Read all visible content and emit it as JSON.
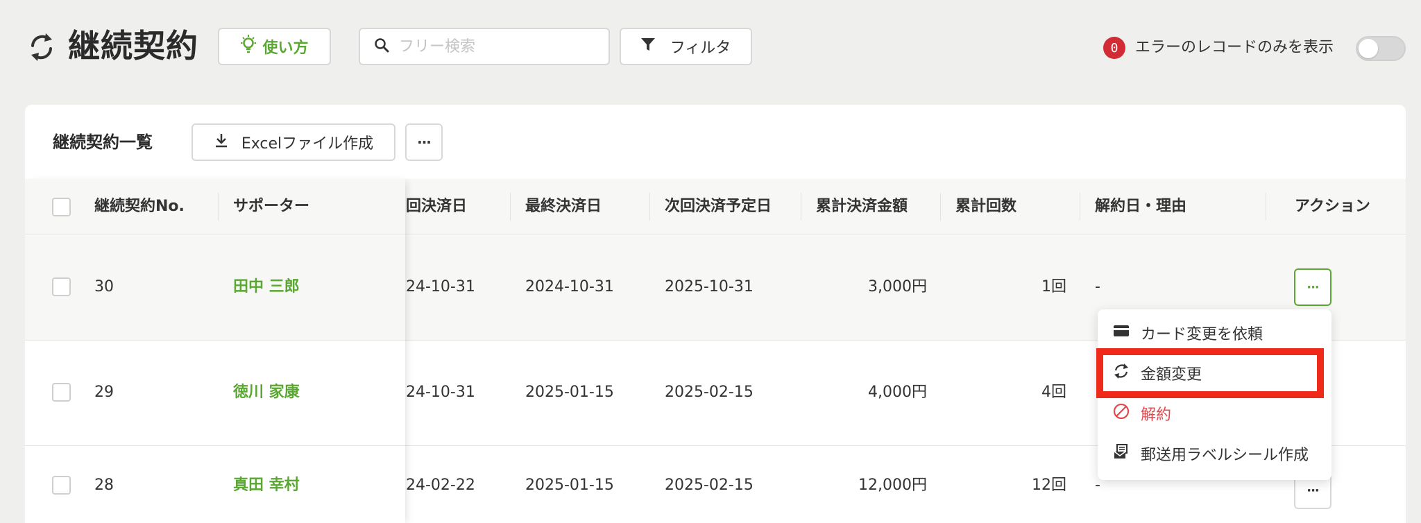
{
  "header": {
    "title": "継続契約",
    "howto_label": "使い方",
    "search_placeholder": "フリー検索",
    "filter_label": "フィルタ",
    "error_count": "0",
    "error_only_label": "エラーのレコードのみを表示",
    "error_toggle_on": false
  },
  "list": {
    "title": "継続契約一覧",
    "excel_label": "Excelファイル作成",
    "more_label": "···"
  },
  "table": {
    "columns": [
      "継続契約No.",
      "サポーター",
      "回決済日",
      "最終決済日",
      "次回決済予定日",
      "累計決済金額",
      "累計回数",
      "解約日・理由",
      "アクション"
    ],
    "rows": [
      {
        "no": "30",
        "supporter": "田中 三郎",
        "first_date": "24-10-31",
        "last_date": "2024-10-31",
        "next_date": "2025-10-31",
        "total": "3,000円",
        "count": "1回",
        "cancel": "-"
      },
      {
        "no": "29",
        "supporter": "徳川 家康",
        "first_date": "24-10-31",
        "last_date": "2025-01-15",
        "next_date": "2025-02-15",
        "total": "4,000円",
        "count": "4回",
        "cancel": ""
      },
      {
        "no": "28",
        "supporter": "真田 幸村",
        "first_date": "24-02-22",
        "last_date": "2025-01-15",
        "next_date": "2025-02-15",
        "total": "12,000円",
        "count": "12回",
        "cancel": "-"
      }
    ],
    "action_label": "···"
  },
  "menu": {
    "items": [
      {
        "label": "カード変更を依頼",
        "icon": "credit-card-icon"
      },
      {
        "label": "金額変更",
        "icon": "refresh-icon"
      },
      {
        "label": "解約",
        "icon": "prohibit-icon"
      },
      {
        "label": "郵送用ラベルシール作成",
        "icon": "mail-label-icon"
      }
    ]
  },
  "colors": {
    "accent": "#5aa832",
    "danger": "#e5484d",
    "badge": "#d22b35",
    "highlight": "#f02a1a"
  }
}
